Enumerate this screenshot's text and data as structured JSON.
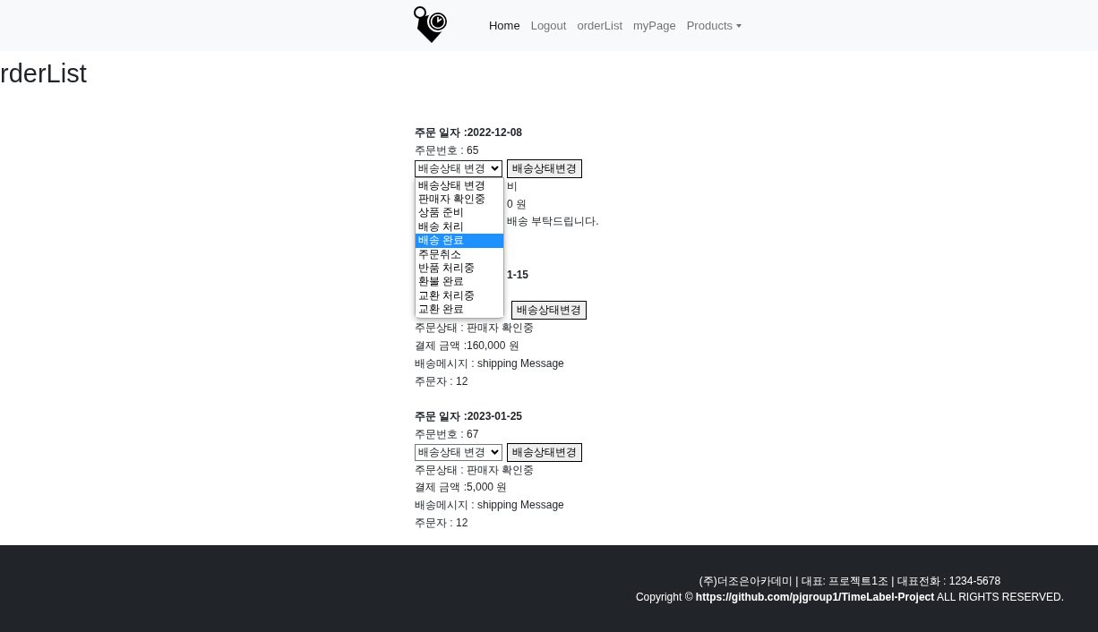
{
  "navbar": {
    "links": [
      {
        "label": "Home",
        "selected": true,
        "kind": "link"
      },
      {
        "label": "Logout",
        "selected": false,
        "kind": "link"
      },
      {
        "label": "orderList",
        "selected": false,
        "kind": "link"
      },
      {
        "label": "myPage",
        "selected": false,
        "kind": "link"
      },
      {
        "label": "Products",
        "selected": false,
        "kind": "dropdown"
      }
    ]
  },
  "page_title": "rderList",
  "orders": [
    {
      "rows": [
        {
          "kind": "date",
          "text": "주문 일자 :2022-12-08"
        },
        {
          "kind": "text",
          "text": "주문번호 : 65"
        },
        {
          "kind": "controls",
          "select": "배송상태 변경",
          "button": "배송상태변경",
          "expanded": true,
          "options": [
            {
              "label": "배송상태 변경",
              "selected": false
            },
            {
              "label": "판매자 확인중",
              "selected": false
            },
            {
              "label": "상품 준비",
              "selected": false
            },
            {
              "label": "배송 처리",
              "selected": false
            },
            {
              "label": "배송 완료",
              "selected": true
            },
            {
              "label": "주문취소",
              "selected": false
            },
            {
              "label": "반품 처리중",
              "selected": false
            },
            {
              "label": "환불 완료",
              "selected": false
            },
            {
              "label": "교환 처리중",
              "selected": false
            },
            {
              "label": "교환 완료",
              "selected": false
            }
          ]
        },
        {
          "kind": "fragment",
          "text": "비"
        },
        {
          "kind": "fragment",
          "text": "0 원"
        },
        {
          "kind": "fragment",
          "text": "배송 부탁드립니다."
        },
        {
          "kind": "hidden"
        }
      ]
    },
    {
      "rows": [
        {
          "kind": "date_fragment",
          "text": "1-15"
        },
        {
          "kind": "hidden"
        },
        {
          "kind": "controls",
          "button": "배송상태변경"
        },
        {
          "kind": "text",
          "text": "주문상태 : 판매자 확인중"
        },
        {
          "kind": "text",
          "text": "결제 금액 :160,000 원"
        },
        {
          "kind": "text",
          "text": "배송메시지 : shipping Message"
        },
        {
          "kind": "text",
          "text": "주문자 : 12"
        }
      ]
    },
    {
      "rows": [
        {
          "kind": "date",
          "text": "주문 일자 :2023-01-25"
        },
        {
          "kind": "text",
          "text": "주문번호 : 67"
        },
        {
          "kind": "controls",
          "select": "배송상태 변경",
          "button": "배송상태변경"
        },
        {
          "kind": "text",
          "text": "주문상태 : 판매자 확인중"
        },
        {
          "kind": "text",
          "text": "결제 금액 :5,000 원"
        },
        {
          "kind": "text",
          "text": "배송메시지 : shipping Message"
        },
        {
          "kind": "text",
          "text": "주문자 : 12"
        }
      ]
    }
  ],
  "footer": {
    "line_1": "(주)더조은아카데미 | 대표: 프로젝트1조 | 대표전화 : 1234-5678",
    "line_2": "Copyright © **https://github.com/pjgroup1/TimeLabel-Project** ALL RIGHTS RESERVED."
  }
}
